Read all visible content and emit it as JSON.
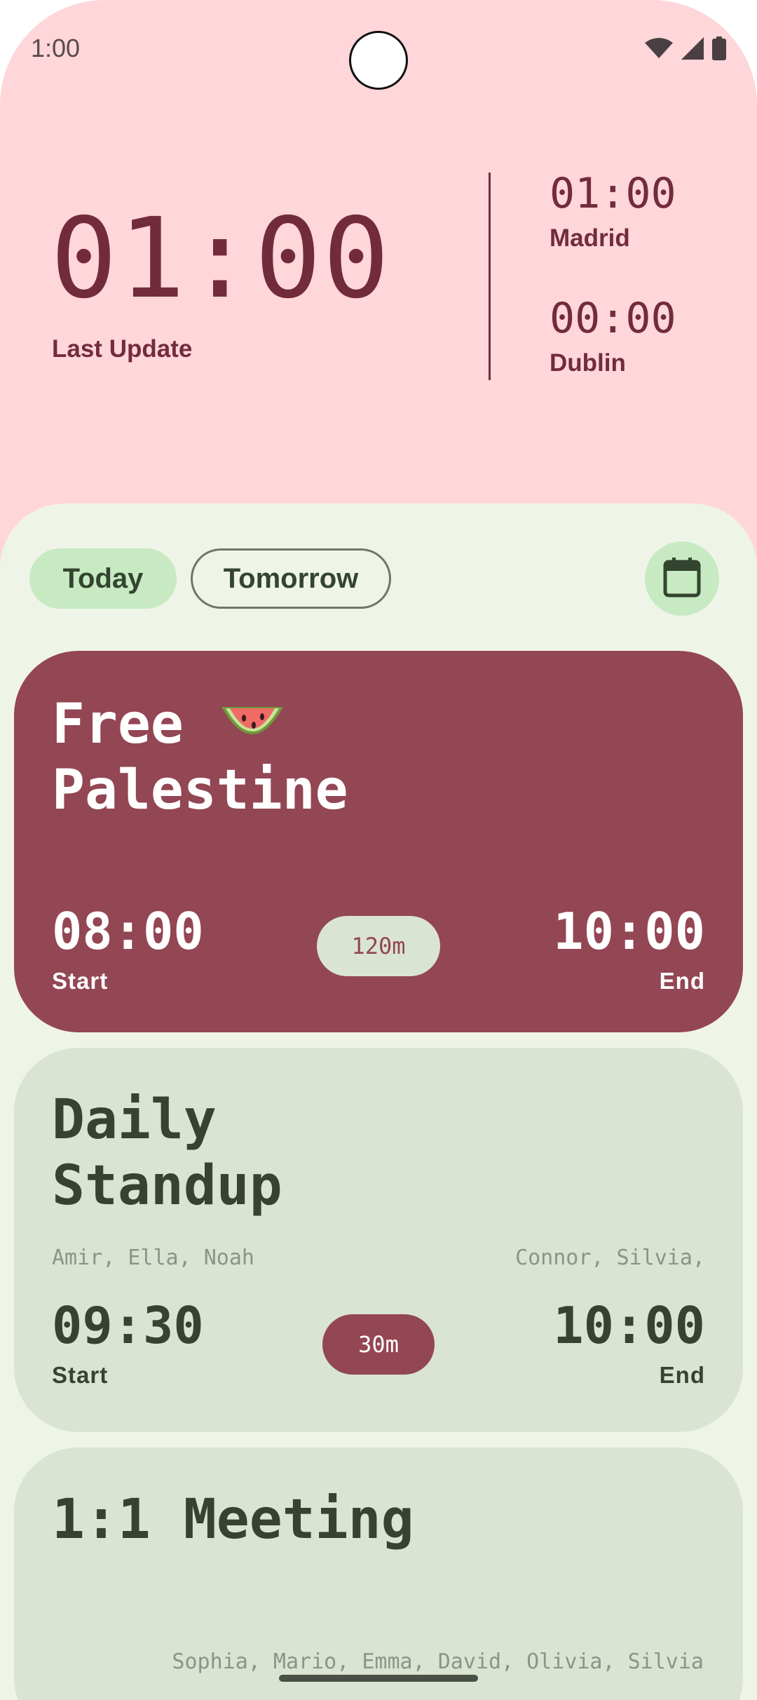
{
  "status_bar": {
    "time": "1:00",
    "icons": [
      "wifi-icon",
      "cellular-signal-icon",
      "battery-icon"
    ]
  },
  "clock": {
    "local_time": "01:00",
    "local_label": "Last Update",
    "zones": [
      {
        "time": "01:00",
        "city": "Madrid"
      },
      {
        "time": "00:00",
        "city": "Dublin"
      }
    ]
  },
  "filters": {
    "today_label": "Today",
    "tomorrow_label": "Tomorrow",
    "selected": "Today",
    "calendar_icon": "calendar-icon"
  },
  "events": [
    {
      "title": "Free\nPalestine",
      "emoji": "watermelon",
      "start": "08:00",
      "start_label": "Start",
      "end": "10:00",
      "end_label": "End",
      "duration": "120m",
      "accent": "#934653"
    },
    {
      "title": "Daily\nStandup",
      "attendees_left": "Amir, Ella, Noah",
      "attendees_right": "Connor, Silvia,",
      "start": "09:30",
      "start_label": "Start",
      "end": "10:00",
      "end_label": "End",
      "duration": "30m"
    },
    {
      "title": "1:1 Meeting",
      "attendees": "Sophia, Mario, Emma, David, Olivia, Silvia"
    }
  ],
  "colors": {
    "hero_bg": "#ffd6da",
    "hero_text": "#722b3d",
    "sheet_bg": "#eff4e8",
    "card_bg": "#dae4d2",
    "chip_selected": "#c7eac2",
    "card_text": "#37432f"
  }
}
